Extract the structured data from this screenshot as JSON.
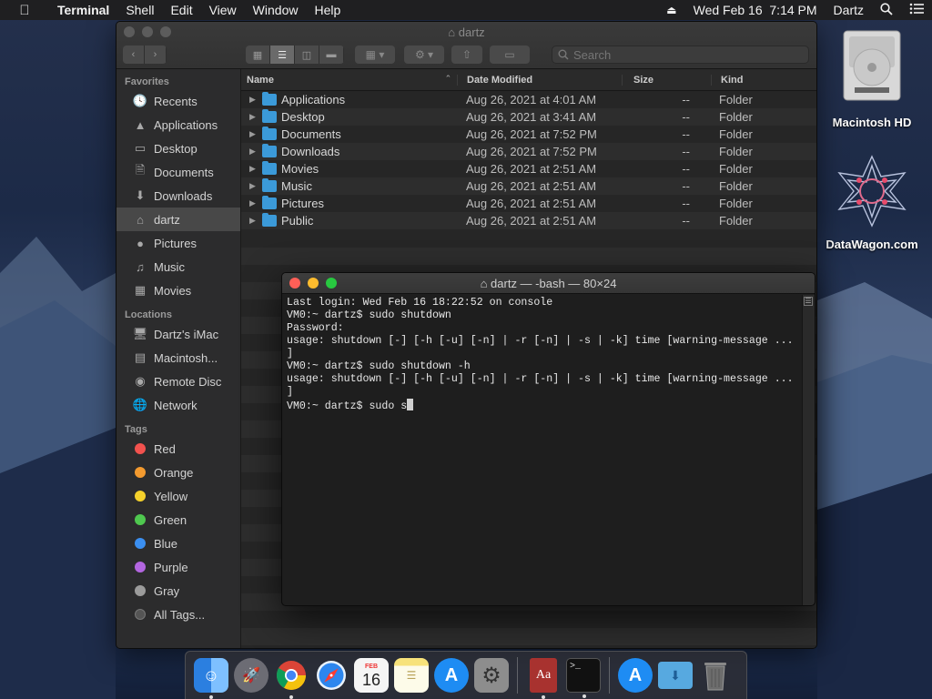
{
  "menubar": {
    "app_name": "Terminal",
    "items": [
      "Shell",
      "Edit",
      "View",
      "Window",
      "Help"
    ],
    "clock": "Wed Feb 16  7:14 PM",
    "user": "Dartz"
  },
  "finder": {
    "title": "dartz",
    "search_placeholder": "Search",
    "sidebar": {
      "favorites_heading": "Favorites",
      "favorites": [
        {
          "label": "Recents",
          "icon": "clock-icon"
        },
        {
          "label": "Applications",
          "icon": "applications-icon"
        },
        {
          "label": "Desktop",
          "icon": "desktop-icon"
        },
        {
          "label": "Documents",
          "icon": "document-icon"
        },
        {
          "label": "Downloads",
          "icon": "download-icon"
        },
        {
          "label": "dartz",
          "icon": "home-icon",
          "selected": true
        },
        {
          "label": "Pictures",
          "icon": "camera-icon"
        },
        {
          "label": "Music",
          "icon": "music-icon"
        },
        {
          "label": "Movies",
          "icon": "film-icon"
        }
      ],
      "locations_heading": "Locations",
      "locations": [
        {
          "label": "Dartz's iMac",
          "icon": "imac-icon"
        },
        {
          "label": "Macintosh...",
          "icon": "harddisk-icon"
        },
        {
          "label": "Remote Disc",
          "icon": "disc-icon"
        },
        {
          "label": "Network",
          "icon": "globe-icon"
        }
      ],
      "tags_heading": "Tags",
      "tags": [
        {
          "label": "Red",
          "color": "#f2524e"
        },
        {
          "label": "Orange",
          "color": "#f39a2f"
        },
        {
          "label": "Yellow",
          "color": "#f5d12b"
        },
        {
          "label": "Green",
          "color": "#4fc84f"
        },
        {
          "label": "Blue",
          "color": "#3b8ff0"
        },
        {
          "label": "Purple",
          "color": "#b366e0"
        },
        {
          "label": "Gray",
          "color": "#9b9b9b"
        },
        {
          "label": "All Tags...",
          "color": "#555555"
        }
      ]
    },
    "columns": {
      "name": "Name",
      "date": "Date Modified",
      "size": "Size",
      "kind": "Kind"
    },
    "rows": [
      {
        "name": "Applications",
        "date": "Aug 26, 2021 at 4:01 AM",
        "size": "--",
        "kind": "Folder"
      },
      {
        "name": "Desktop",
        "date": "Aug 26, 2021 at 3:41 AM",
        "size": "--",
        "kind": "Folder"
      },
      {
        "name": "Documents",
        "date": "Aug 26, 2021 at 7:52 PM",
        "size": "--",
        "kind": "Folder"
      },
      {
        "name": "Downloads",
        "date": "Aug 26, 2021 at 7:52 PM",
        "size": "--",
        "kind": "Folder"
      },
      {
        "name": "Movies",
        "date": "Aug 26, 2021 at 2:51 AM",
        "size": "--",
        "kind": "Folder"
      },
      {
        "name": "Music",
        "date": "Aug 26, 2021 at 2:51 AM",
        "size": "--",
        "kind": "Folder"
      },
      {
        "name": "Pictures",
        "date": "Aug 26, 2021 at 2:51 AM",
        "size": "--",
        "kind": "Folder"
      },
      {
        "name": "Public",
        "date": "Aug 26, 2021 at 2:51 AM",
        "size": "--",
        "kind": "Folder"
      }
    ]
  },
  "terminal": {
    "title": "dartz — -bash — 80×24",
    "lines": [
      "Last login: Wed Feb 16 18:22:52 on console",
      "VM0:~ dartz$ sudo shutdown",
      "Password:",
      "usage: shutdown [-] [-h [-u] [-n] | -r [-n] | -s | -k] time [warning-message ...",
      "]",
      "VM0:~ dartz$ sudo shutdown -h",
      "usage: shutdown [-] [-h [-u] [-n] | -r [-n] | -s | -k] time [warning-message ...",
      "]"
    ],
    "prompt_line": "VM0:~ dartz$ sudo s"
  },
  "desktop": {
    "icons": [
      {
        "label": "Macintosh HD",
        "icon": "harddisk-icon"
      },
      {
        "label": "DataWagon.com",
        "icon": "datawagon-logo-icon"
      }
    ]
  },
  "dock": {
    "items": [
      {
        "name": "finder-icon",
        "bg": "#2e8ff0",
        "running": true
      },
      {
        "name": "launchpad-icon",
        "bg": "#6c6c74",
        "running": false
      },
      {
        "name": "chrome-icon",
        "bg": "#e8e8e8",
        "running": true
      },
      {
        "name": "safari-icon",
        "bg": "#2c86ee",
        "running": false
      },
      {
        "name": "calendar-icon",
        "bg": "#f5f5f5",
        "running": false,
        "text": "16",
        "month": "FEB"
      },
      {
        "name": "notes-icon",
        "bg": "#f7e27a",
        "running": false
      },
      {
        "name": "app-store-icon",
        "bg": "#1e8cf3",
        "running": false
      },
      {
        "name": "system-preferences-icon",
        "bg": "#8d8d8d",
        "running": false
      },
      {
        "name": "dictionary-icon",
        "bg": "#a8322f",
        "running": true,
        "text": "Aa"
      },
      {
        "name": "terminal-icon",
        "bg": "#111111",
        "running": true,
        "text": ">_"
      }
    ],
    "right_items": [
      {
        "name": "app-store-downloads-icon",
        "bg": "#1e8cf3"
      },
      {
        "name": "downloads-folder-icon",
        "bg": "#57a9e0"
      },
      {
        "name": "trash-icon",
        "bg": "#7a7a7a"
      }
    ]
  }
}
